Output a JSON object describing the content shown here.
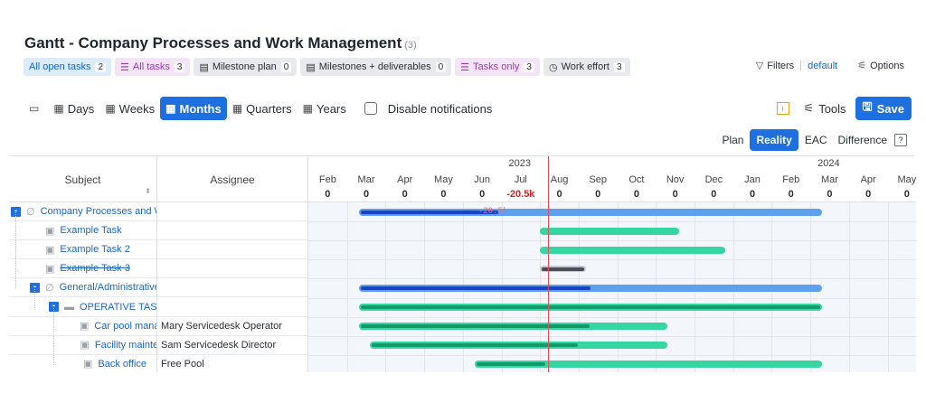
{
  "header": {
    "title": "Gantt - Company Processes and Work Management",
    "count": "(3)"
  },
  "queries": [
    {
      "label": "All open tasks",
      "badge": "2",
      "style": "blue",
      "icon": ""
    },
    {
      "label": "All tasks",
      "badge": "3",
      "style": "purple",
      "icon": "list-icon"
    },
    {
      "label": "Milestone plan",
      "badge": "0",
      "style": "gray",
      "icon": "milestone-icon"
    },
    {
      "label": "Milestones + deliverables",
      "badge": "0",
      "style": "gray",
      "icon": "milestone-icon"
    },
    {
      "label": "Tasks only",
      "badge": "3",
      "style": "purple",
      "icon": "list-icon"
    },
    {
      "label": "Work effort",
      "badge": "3",
      "style": "gray",
      "icon": "clock-icon"
    }
  ],
  "filters": {
    "label": "Filters",
    "preset": "default",
    "options": "Options"
  },
  "toolbar": {
    "zoom": [
      {
        "label": "Days",
        "active": false
      },
      {
        "label": "Weeks",
        "active": false
      },
      {
        "label": "Months",
        "active": true
      },
      {
        "label": "Quarters",
        "active": false
      },
      {
        "label": "Years",
        "active": false
      }
    ],
    "disable_notifications": "Disable notifications",
    "info": "i",
    "tools": "Tools",
    "save": "Save"
  },
  "modes": [
    {
      "label": "Plan",
      "active": false
    },
    {
      "label": "Reality",
      "active": true
    },
    {
      "label": "EAC",
      "active": false
    },
    {
      "label": "Difference",
      "active": false
    }
  ],
  "help": "?",
  "columns": {
    "subject": "Subject",
    "assignee": "Assignee"
  },
  "timeline": {
    "years": [
      {
        "label": "2023",
        "month_index": 5
      },
      {
        "label": "2024",
        "month_index": 13
      }
    ],
    "months": [
      "Feb",
      "Mar",
      "Apr",
      "May",
      "Jun",
      "Jul",
      "Aug",
      "Sep",
      "Oct",
      "Nov",
      "Dec",
      "Jan",
      "Feb",
      "Mar",
      "Apr",
      "May"
    ],
    "values": [
      "0",
      "0",
      "0",
      "0",
      "0",
      "-20.5k",
      "0",
      "0",
      "0",
      "0",
      "0",
      "0",
      "0",
      "0",
      "0",
      "0"
    ],
    "today_month": 6.2
  },
  "rows": [
    {
      "subject": "Company Processes and Work Management",
      "assignee": "",
      "level": 0,
      "toggle": "-",
      "icon": "project-icon",
      "strike": false,
      "bar": {
        "type": "blue",
        "start": 1.3,
        "end": 13.3,
        "progress": 0.3,
        "label": "-20.5k"
      }
    },
    {
      "subject": "Example Task",
      "assignee": "",
      "level": 1,
      "toggle": "",
      "icon": "task-icon",
      "strike": false,
      "bar": {
        "type": "green",
        "start": 6.0,
        "end": 9.6,
        "progress": 0
      }
    },
    {
      "subject": "Example Task 2",
      "assignee": "",
      "level": 1,
      "toggle": "",
      "icon": "task-icon",
      "strike": false,
      "bar": {
        "type": "green",
        "start": 6.0,
        "end": 10.8,
        "progress": 0
      }
    },
    {
      "subject": "Example Task 3",
      "assignee": "",
      "level": 1,
      "toggle": "",
      "icon": "task-icon",
      "strike": true,
      "bar": {
        "type": "gray",
        "start": 6.0,
        "end": 7.2,
        "progress": 1
      }
    },
    {
      "subject": "General/Administrative",
      "assignee": "",
      "level": 1,
      "toggle": "-",
      "icon": "project-icon",
      "strike": false,
      "bar": {
        "type": "blue",
        "start": 1.3,
        "end": 13.3,
        "progress": 0.5
      }
    },
    {
      "subject": "OPERATIVE TASKS",
      "assignee": "",
      "level": 2,
      "toggle": "-",
      "icon": "folder-icon",
      "strike": false,
      "bar": {
        "type": "green",
        "start": 1.3,
        "end": 13.3,
        "progress": 1
      }
    },
    {
      "subject": "Car pool management",
      "assignee": "Mary Servicedesk Operator",
      "level": 3,
      "toggle": "",
      "icon": "task-icon",
      "strike": false,
      "bar": {
        "type": "green",
        "start": 1.3,
        "end": 9.3,
        "progress": 0.75
      }
    },
    {
      "subject": "Facility maintenance",
      "assignee": "Sam Servicedesk Director",
      "level": 3,
      "toggle": "",
      "icon": "task-icon",
      "strike": false,
      "bar": {
        "type": "green",
        "start": 1.6,
        "end": 9.3,
        "progress": 0.7
      }
    },
    {
      "subject": "Back office",
      "assignee": "Free Pool",
      "level": 3,
      "toggle": "",
      "icon": "task-icon",
      "strike": false,
      "bar": {
        "type": "green",
        "start": 4.3,
        "end": 13.3,
        "progress": 0.2
      }
    }
  ],
  "colors": {
    "accent": "#1e6fe0",
    "bar_blue": "#5ea0ee",
    "bar_green": "#35d6a0",
    "today": "#e84a55"
  }
}
